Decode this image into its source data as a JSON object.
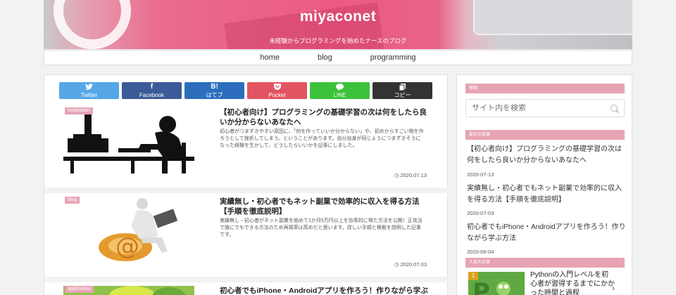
{
  "header": {
    "site_title": "miyaconet",
    "tagline": "未経験からプログラミングを始めたナースのブログ"
  },
  "nav": [
    "home",
    "blog",
    "programming"
  ],
  "share": [
    {
      "icon": "twitter-icon",
      "glyph": "🐦",
      "label": "Twitter",
      "color": "#55a7e8"
    },
    {
      "icon": "facebook-icon",
      "glyph": "f",
      "label": "Facebook",
      "color": "#3b5a98"
    },
    {
      "icon": "hatena-icon",
      "glyph": "B!",
      "label": "はてブ",
      "color": "#2c6ebd"
    },
    {
      "icon": "pocket-icon",
      "glyph": "⌄",
      "label": "Pocket",
      "color": "#e35462"
    },
    {
      "icon": "line-icon",
      "glyph": "💬",
      "label": "LINE",
      "color": "#3cc23a"
    },
    {
      "icon": "copy-icon",
      "glyph": "❐",
      "label": "コピー",
      "color": "#333333"
    }
  ],
  "posts": [
    {
      "category": "motivation",
      "title": "【初心者向け】プログラミングの基礎学習の次は何をしたら良いか分からないあなたへ",
      "excerpt": "初心者がつまずきやすい原因に、「何を作っていいか分からない」や、初めからすごい物を作ろうとして挫折してしまう。ということがあります。自分自身が同じようにつまずきそうになった経験を生かして、どうしたらいいかを記事にしました。",
      "date": "2020.07.13"
    },
    {
      "category": "blog",
      "title": "実績無し・初心者でもネット副業で効率的に収入を得る方法【手順を徹底説明】",
      "excerpt": "実績無し・初心者がネット副業を始めて1か月5万円以上を効率的に得た方法を公開！正攻法で誰にでもできる方法のため再現率は高めだと思います。詳しい手順と根拠を説明した記事です。",
      "date": "2020.07.03"
    },
    {
      "category": "application",
      "title": "初心者でもiPhone・Androidアプリを作ろう！作りながら学ぶ方法"
    }
  ],
  "sidebar": {
    "search_heading": "検索",
    "search_placeholder": "サイト内を検索",
    "recent_heading": "最近の投稿",
    "recent": [
      {
        "title": "【初心者向け】プログラミングの基礎学習の次は何をしたら良いか分からないあなたへ",
        "date": "2020-07-13"
      },
      {
        "title": "実績無し・初心者でもネット副業で効率的に収入を得る方法【手順を徹底説明】",
        "date": "2020-07-03"
      },
      {
        "title": "初心者でもiPhone・Androidアプリを作ろう！作りながら学ぶ方法",
        "date": "2020-06-04"
      }
    ],
    "popular_heading": "人気の記事",
    "popular": [
      {
        "rank": "1",
        "title": "Pythonの入門レベルを初心者が習得するまでにかかった時間と過程"
      }
    ]
  }
}
